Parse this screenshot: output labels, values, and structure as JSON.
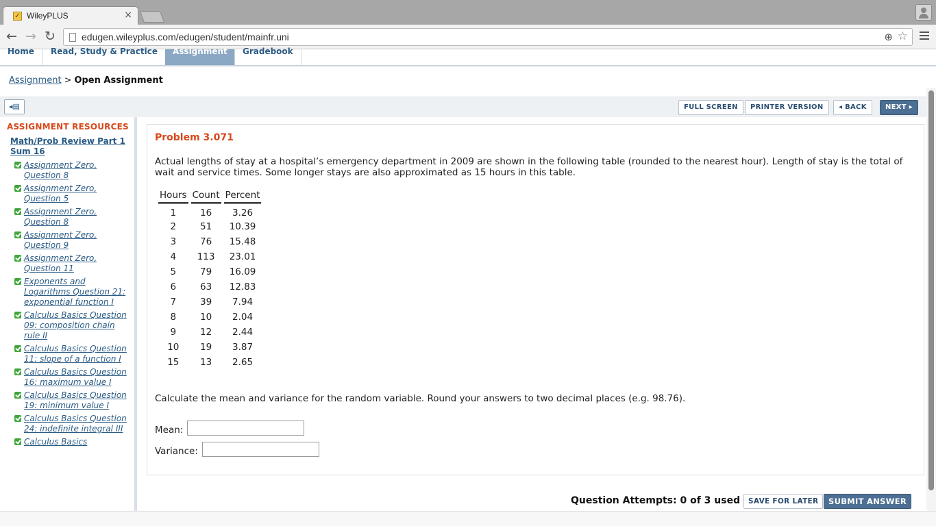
{
  "browser": {
    "tab_title": "WileyPLUS",
    "tab_close": "×",
    "url": "edugen.wileyplus.com/edugen/student/mainfr.uni",
    "back": "←",
    "forward": "→",
    "reload": "↻"
  },
  "nav": {
    "items": [
      {
        "label": "Home"
      },
      {
        "label": "Read, Study & Practice"
      },
      {
        "label": "Assignment"
      },
      {
        "label": "Gradebook"
      }
    ]
  },
  "breadcrumb": {
    "link": "Assignment",
    "separator": ">",
    "current": "Open Assignment"
  },
  "actions": {
    "full_screen": "FULL SCREEN",
    "printer_version": "PRINTER VERSION",
    "back": "◂ BACK",
    "next": "NEXT ▸"
  },
  "sidebar": {
    "title": "ASSIGNMENT RESOURCES",
    "section": "Math/Prob Review Part 1 Sum 16",
    "items": [
      {
        "label": "Assignment Zero, Question 8"
      },
      {
        "label": "Assignment Zero, Question 5"
      },
      {
        "label": "Assignment Zero, Question 8"
      },
      {
        "label": "Assignment Zero, Question 9"
      },
      {
        "label": "Assignment Zero, Question 11"
      },
      {
        "label": "Exponents and Logarithms Question 21: exponential function I"
      },
      {
        "label": "Calculus Basics Question 09: composition chain rule II"
      },
      {
        "label": "Calculus Basics Question 11: slope of a function I"
      },
      {
        "label": "Calculus Basics Question 16: maximum value I"
      },
      {
        "label": "Calculus Basics Question 19: minimum value I"
      },
      {
        "label": "Calculus Basics Question 24: indefinite integral III"
      },
      {
        "label": "Calculus Basics"
      }
    ]
  },
  "problem": {
    "title": "Problem 3.071",
    "text": "Actual lengths of stay at a hospital’s emergency department in 2009 are shown in the following table (rounded to the nearest hour). Length of stay is the total of wait and service times. Some longer stays are also approximated as 15 hours in this table.",
    "table": {
      "headers": [
        "Hours",
        "Count",
        "Percent"
      ],
      "rows": [
        [
          "1",
          "16",
          "3.26"
        ],
        [
          "2",
          "51",
          "10.39"
        ],
        [
          "3",
          "76",
          "15.48"
        ],
        [
          "4",
          "113",
          "23.01"
        ],
        [
          "5",
          "79",
          "16.09"
        ],
        [
          "6",
          "63",
          "12.83"
        ],
        [
          "7",
          "39",
          "7.94"
        ],
        [
          "8",
          "10",
          "2.04"
        ],
        [
          "9",
          "12",
          "2.44"
        ],
        [
          "10",
          "19",
          "3.87"
        ],
        [
          "15",
          "13",
          "2.65"
        ]
      ]
    },
    "question": "Calculate the mean and variance for the random variable. Round your answers to two decimal places (e.g. 98.76).",
    "mean_label": "Mean:",
    "mean_value": "",
    "variance_label": "Variance:",
    "variance_value": ""
  },
  "footer": {
    "attempts": "Question Attempts: 0 of 3 used",
    "save_for_later": "SAVE FOR LATER",
    "submit_answer": "SUBMIT ANSWER"
  }
}
